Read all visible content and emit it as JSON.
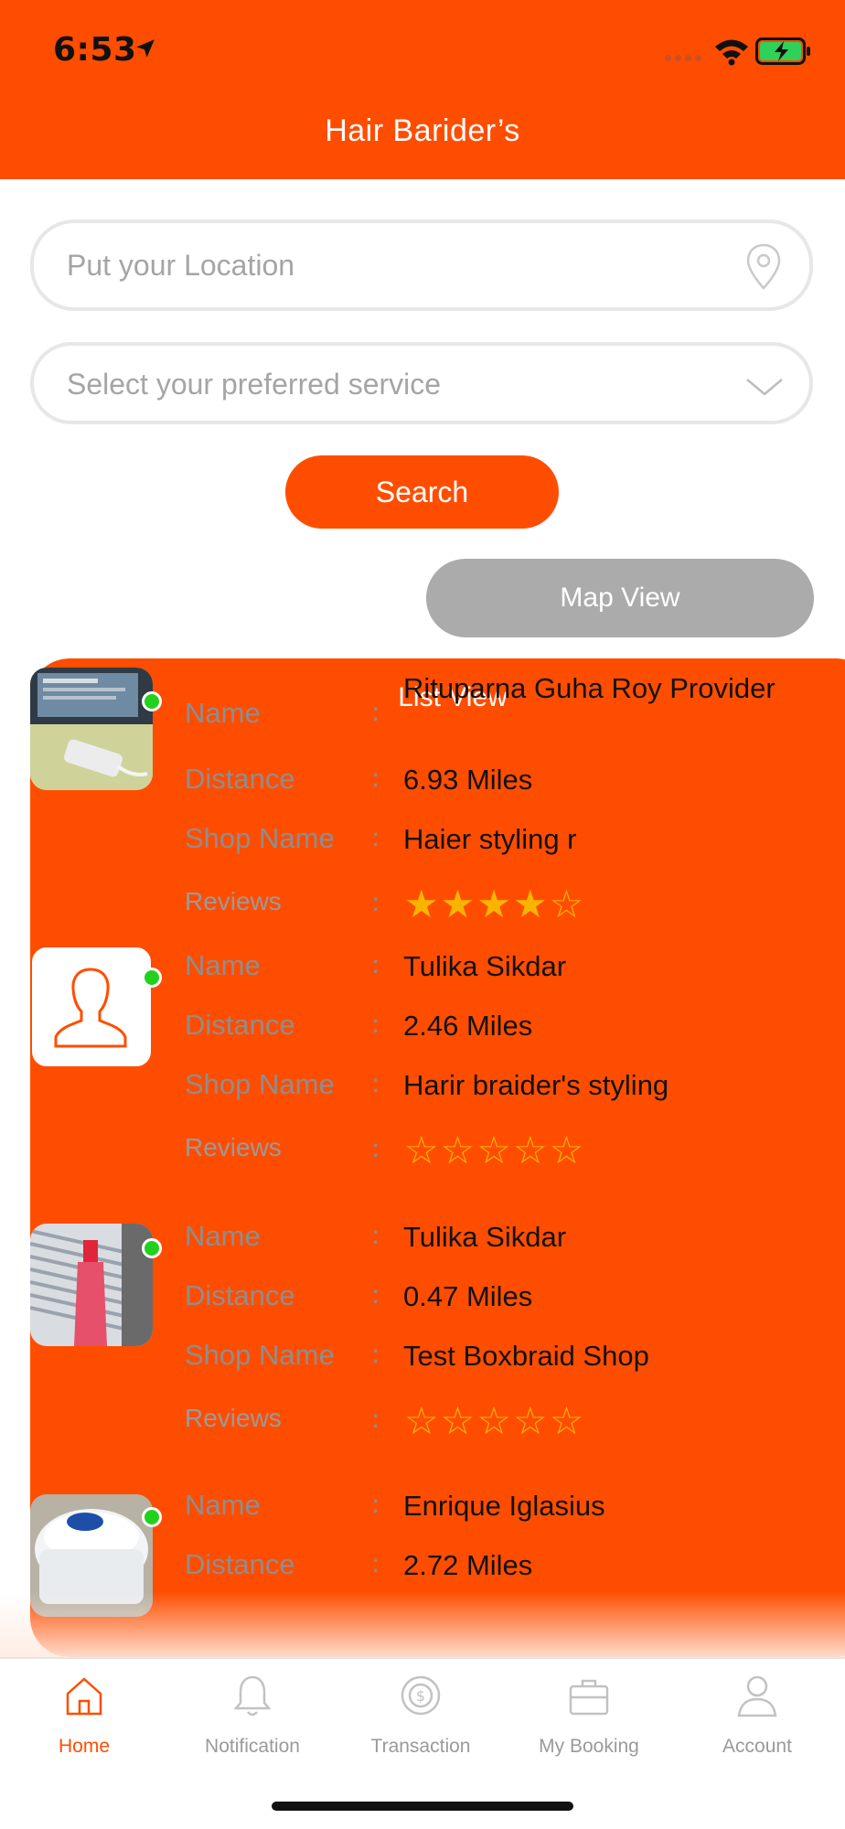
{
  "status_bar": {
    "time": "6:53"
  },
  "header": {
    "title": "Hair Barider’s"
  },
  "search": {
    "location_placeholder": "Put your Location",
    "service_placeholder": "Select your preferred service",
    "button_label": "Search"
  },
  "view_toggle": {
    "list_label": "List View",
    "map_label": "Map View",
    "active": "List View"
  },
  "labels": {
    "name": "Name",
    "distance": "Distance",
    "shop_name": "Shop Name",
    "reviews": "Reviews",
    "separator": ":"
  },
  "providers": [
    {
      "name": "Rituparna Guha Roy Provider",
      "distance": "6.93 Miles",
      "shop_name": "Haier styling r",
      "rating": 4,
      "rating_stars": "★★★★☆",
      "online": true,
      "photo": "desk-photo"
    },
    {
      "name": "Tulika Sikdar",
      "distance": "2.46 Miles",
      "shop_name": "Harir braider's styling",
      "rating": 0,
      "rating_stars": "☆☆☆☆☆",
      "online": true,
      "photo": "default-avatar"
    },
    {
      "name": "Tulika Sikdar",
      "distance": "0.47 Miles",
      "shop_name": "Test Boxbraid Shop",
      "rating": 0,
      "rating_stars": "☆☆☆☆☆",
      "online": true,
      "photo": "bottle-photo"
    },
    {
      "name": "Enrique Iglasius",
      "distance": "2.72 Miles",
      "online": true,
      "photo": "jar-photo"
    }
  ],
  "tabbar": {
    "items": [
      {
        "label": "Home",
        "icon": "home-icon",
        "active": true
      },
      {
        "label": "Notification",
        "icon": "bell-icon",
        "active": false
      },
      {
        "label": "Transaction",
        "icon": "coin-icon",
        "active": false
      },
      {
        "label": "My Booking",
        "icon": "briefcase-icon",
        "active": false
      },
      {
        "label": "Account",
        "icon": "person-icon",
        "active": false
      }
    ]
  },
  "colors": {
    "accent": "#FF4D00",
    "inactive_toggle": "#ABABAB",
    "star": "#F7B500",
    "online": "#22D11E"
  }
}
